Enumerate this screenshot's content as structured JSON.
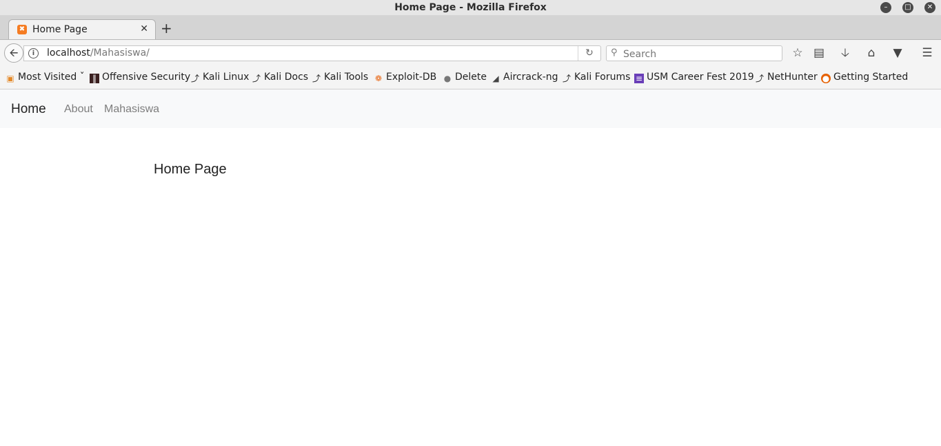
{
  "window": {
    "title": "Home Page - Mozilla Firefox"
  },
  "tabs": [
    {
      "label": "Home Page"
    }
  ],
  "urlbar": {
    "host": "localhost",
    "path": "/Mahasiswa/"
  },
  "search": {
    "placeholder": "Search"
  },
  "bookmarks": [
    {
      "label": "Most Visited",
      "icon": "folder-icon"
    },
    {
      "label": "Offensive Security",
      "icon": "offsec-icon"
    },
    {
      "label": "Kali Linux",
      "icon": "kali-dragon-icon"
    },
    {
      "label": "Kali Docs",
      "icon": "kali-dragon-icon"
    },
    {
      "label": "Kali Tools",
      "icon": "kali-dragon-icon"
    },
    {
      "label": "Exploit-DB",
      "icon": "exploit-db-icon"
    },
    {
      "label": "Delete",
      "icon": "globe-icon"
    },
    {
      "label": "Aircrack-ng",
      "icon": "aircrack-icon"
    },
    {
      "label": "Kali Forums",
      "icon": "kali-dragon-icon"
    },
    {
      "label": "USM Career Fest 2019",
      "icon": "form-icon"
    },
    {
      "label": "NetHunter",
      "icon": "kali-dragon-icon"
    },
    {
      "label": "Getting Started",
      "icon": "firefox-icon"
    }
  ],
  "site_nav": {
    "brand": "Home",
    "links": [
      "About",
      "Mahasiswa"
    ]
  },
  "main": {
    "heading": "Home Page"
  }
}
